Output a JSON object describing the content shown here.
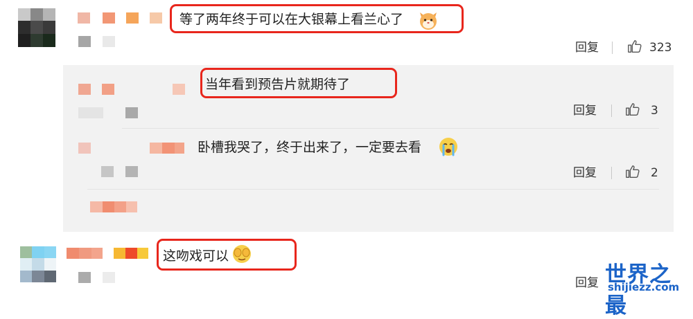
{
  "comments": [
    {
      "text": "等了两年终于可以在大银幕上看兰心了",
      "emoji": "cat-face-icon",
      "reply_label": "回复",
      "likes": "323",
      "replies": [
        {
          "text": "当年看到预告片就期待了",
          "reply_label": "回复",
          "likes": "3"
        },
        {
          "text": "卧槽我哭了，终于出来了，一定要去看",
          "emoji": "crying-face-icon",
          "reply_label": "回复",
          "likes": "2"
        }
      ]
    },
    {
      "text": "这吻戏可以",
      "emoji": "covering-eyes-face-icon",
      "reply_label": "回复"
    }
  ],
  "watermark": {
    "title": "世界之最",
    "url": "shijiezz.com"
  },
  "colors": {
    "highlight": "#e8261c",
    "watermark": "#1c64c8",
    "reply_bg": "#f2f2f2"
  }
}
